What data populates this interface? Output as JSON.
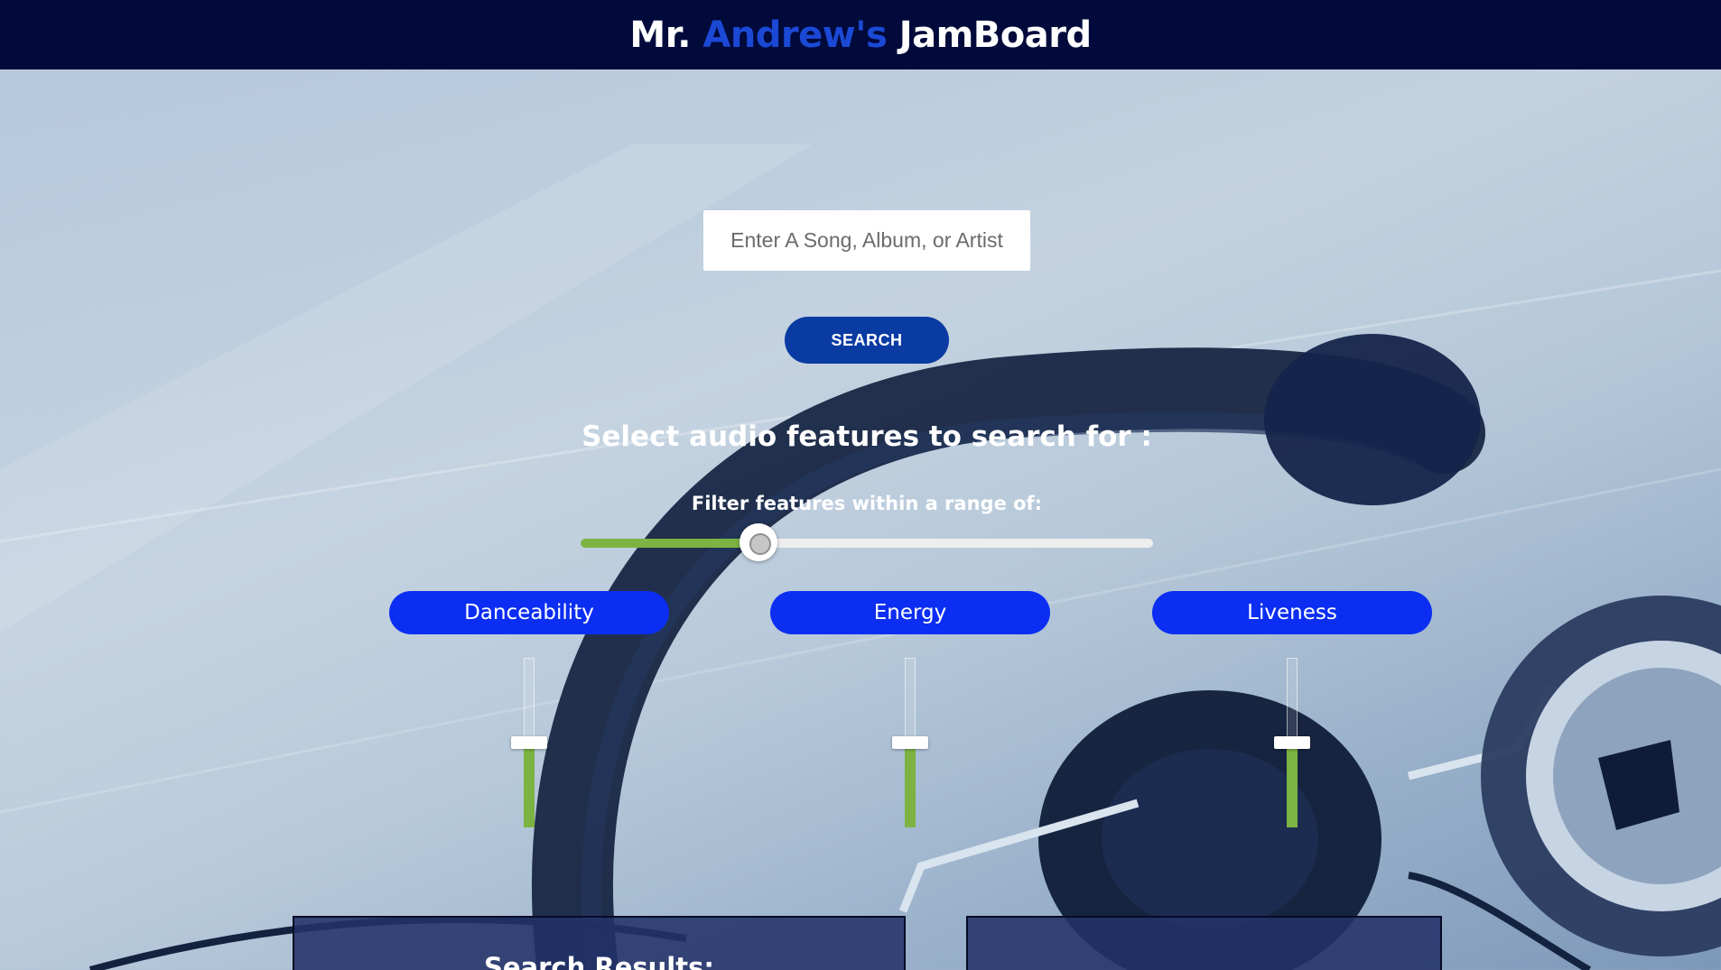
{
  "header": {
    "brand_prefix": "Mr.",
    "brand_accent": "Andrew's",
    "brand_suffix": "JamBoard",
    "accent_color": "#1b49d6",
    "background_color": "#010a3b"
  },
  "search": {
    "placeholder": "Enter A Song, Album, or Artist",
    "value": "",
    "button_label": "SEARCH"
  },
  "features": {
    "heading": "Select audio features to search for :",
    "range_label": "Filter features within a range of:",
    "range_value_fraction": 0.31,
    "items": [
      {
        "label": "Danceability",
        "level_fraction": 0.5
      },
      {
        "label": "Energy",
        "level_fraction": 0.5
      },
      {
        "label": "Liveness",
        "level_fraction": 0.5
      }
    ]
  },
  "results": {
    "title": "Search Results:"
  },
  "colors": {
    "feature_button": "#0b2ef2",
    "slider_fill": "#7cb342",
    "search_button": "#0a3ba3"
  }
}
